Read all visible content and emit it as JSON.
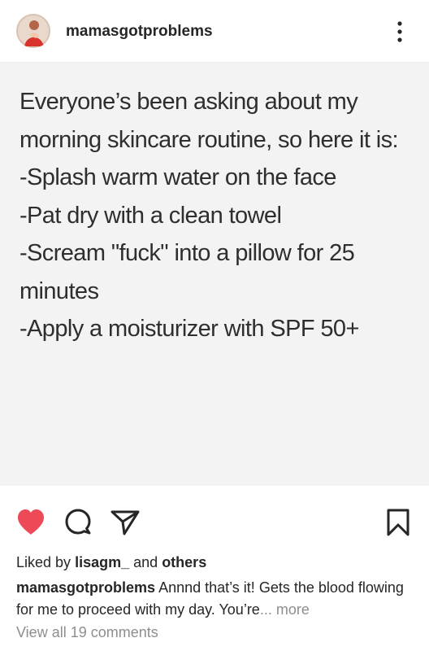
{
  "post": {
    "username": "mamasgotproblems",
    "image_text": [
      "Everyone’s been asking about my",
      "morning skincare routine, so here it is:",
      "-Splash warm water on the face",
      "-Pat dry with a clean towel",
      "-Scream \"fuck\" into a pillow for 25",
      "minutes",
      "-Apply a moisturizer with SPF 50+"
    ],
    "liked_prefix": "Liked by",
    "liked_user": "lisagm_",
    "liked_and": "and",
    "liked_others": "others",
    "caption_user": "mamasgotproblems",
    "caption_text": "Annnd that’s it! Gets the blood flowing for me to proceed with my day. You’re",
    "caption_more": "... more",
    "view_comments": "View all 19 comments",
    "liked_state": true
  },
  "icons": {
    "avatar": "profile-avatar",
    "more": "more-options-icon",
    "like": "heart-icon",
    "comment": "comment-icon",
    "share": "send-icon",
    "save": "bookmark-icon"
  },
  "colors": {
    "like_red": "#ed4956",
    "text": "#262626",
    "muted": "#8e8e8e",
    "image_bg": "#f3f3f3"
  }
}
